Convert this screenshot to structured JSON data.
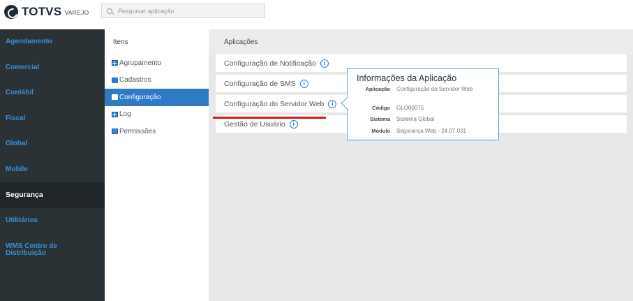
{
  "header": {
    "brand": "TOTVS",
    "brand_sub": "VAREJO",
    "search_placeholder": "Pesquisar aplicação"
  },
  "sidebar": {
    "items": [
      {
        "label": "Agendamento"
      },
      {
        "label": "Comercial"
      },
      {
        "label": "Contábil"
      },
      {
        "label": "Fiscal"
      },
      {
        "label": "Global"
      },
      {
        "label": "Mobile"
      },
      {
        "label": "Segurança",
        "active": true
      },
      {
        "label": "Utilitários"
      },
      {
        "label_line1": "WMS Centro de",
        "label_line2": "Distribuição"
      }
    ]
  },
  "items_panel": {
    "title": "Itens",
    "items": [
      {
        "label": "Agrupamento",
        "icon": "table-icon"
      },
      {
        "label": "Cadastros",
        "icon": "briefcase-icon"
      },
      {
        "label": "Configuração",
        "icon": "briefcase-icon",
        "active": true
      },
      {
        "label": "Log",
        "icon": "table-icon"
      },
      {
        "label": "Permissões",
        "icon": "permissions-icon"
      }
    ]
  },
  "main": {
    "title": "Aplicações",
    "apps": [
      {
        "label": "Configuração de Notificação"
      },
      {
        "label": "Configuração de SMS"
      },
      {
        "label": "Configuração do Servidor Web"
      },
      {
        "label": "Gestão de Usuário"
      }
    ],
    "info_glyph": "i"
  },
  "popover": {
    "title": "Informações da Aplicação",
    "rows": [
      {
        "label": "Aplicação",
        "value": "Configuração do Servidor Web"
      },
      {
        "label": "Código",
        "value": "GLO00075"
      },
      {
        "label": "Sistema",
        "value": "Sistema Global"
      },
      {
        "label": "Módulo",
        "value": "Segurança Web - 24.07.031"
      }
    ]
  },
  "colors": {
    "sidebar_bg": "#2b3236",
    "sidebar_link": "#3a8fd6",
    "accent": "#2f79c5",
    "underline": "#d9141f"
  }
}
